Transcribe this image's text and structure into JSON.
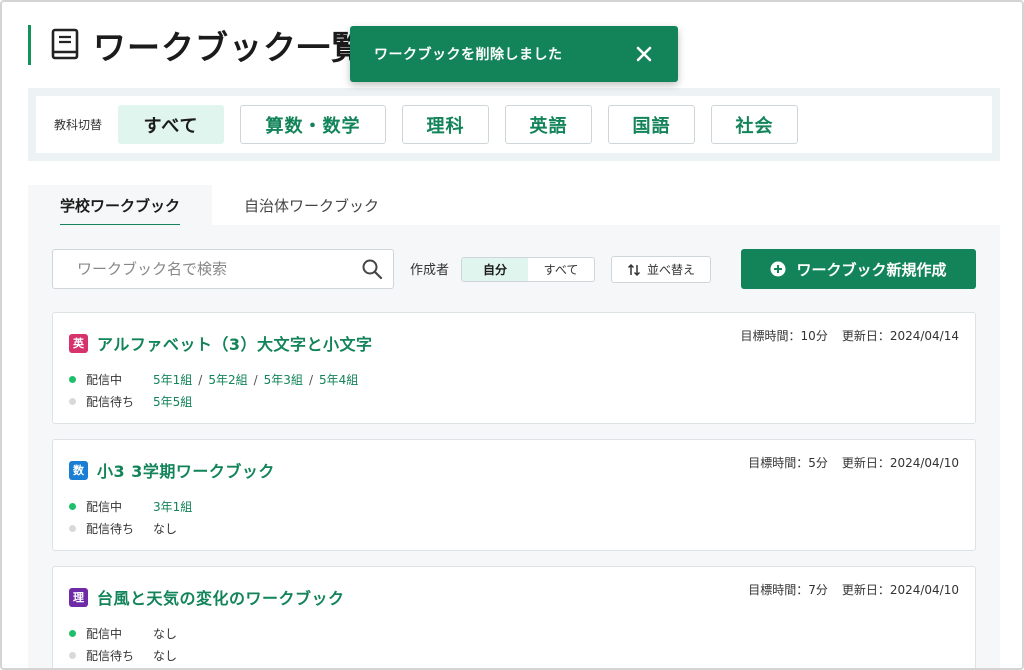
{
  "header": {
    "title": "ワークブック一覧"
  },
  "toast": {
    "message": "ワークブックを削除しました"
  },
  "subject_filter": {
    "label": "教科切替",
    "chips": [
      {
        "label": "すべて",
        "active": true
      },
      {
        "label": "算数・数学",
        "active": false
      },
      {
        "label": "理科",
        "active": false
      },
      {
        "label": "英語",
        "active": false
      },
      {
        "label": "国語",
        "active": false
      },
      {
        "label": "社会",
        "active": false
      }
    ]
  },
  "tabs": [
    {
      "label": "学校ワークブック",
      "active": true
    },
    {
      "label": "自治体ワークブック",
      "active": false
    }
  ],
  "toolbar": {
    "search_placeholder": "ワークブック名で検索",
    "creator_label": "作成者",
    "creator_options": [
      {
        "label": "自分",
        "active": true
      },
      {
        "label": "すべて",
        "active": false
      }
    ],
    "sort_label": "並べ替え",
    "create_label": "ワークブック新規作成"
  },
  "workbooks": [
    {
      "badge": "英",
      "badge_color": "#d6336c",
      "title": "アルファベット（3）大文字と小文字",
      "target_time": "目標時間：10分",
      "updated": "更新日：2024/04/14",
      "delivering_label": "配信中",
      "delivering": [
        "5年1組",
        "5年2組",
        "5年3組",
        "5年4組"
      ],
      "waiting_label": "配信待ち",
      "waiting": [
        "5年5組"
      ]
    },
    {
      "badge": "数",
      "badge_color": "#1a7fd4",
      "title": "小3 3学期ワークブック",
      "target_time": "目標時間：5分",
      "updated": "更新日：2024/04/10",
      "delivering_label": "配信中",
      "delivering": [
        "3年1組"
      ],
      "waiting_label": "配信待ち",
      "waiting_none": "なし"
    },
    {
      "badge": "理",
      "badge_color": "#6f2aa8",
      "title": "台風と天気の変化のワークブック",
      "target_time": "目標時間：7分",
      "updated": "更新日：2024/04/10",
      "delivering_label": "配信中",
      "delivering_none": "なし",
      "waiting_label": "配信待ち",
      "waiting_none": "なし"
    }
  ]
}
